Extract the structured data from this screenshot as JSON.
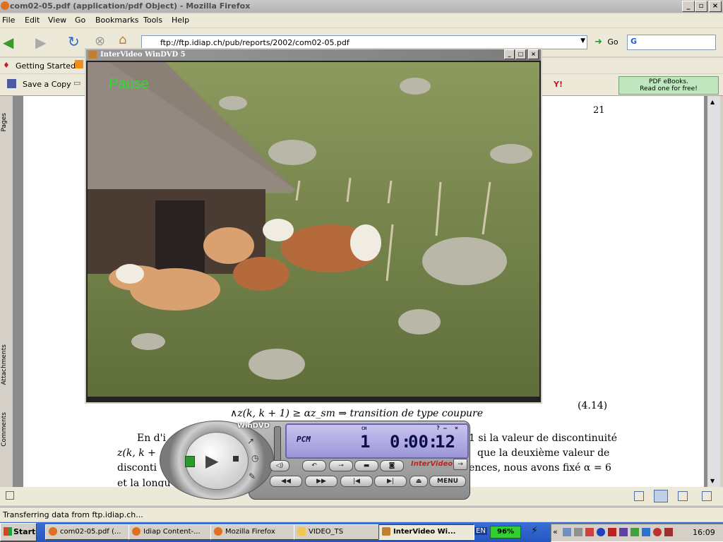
{
  "firefox": {
    "title": "com02-05.pdf (application/pdf Object) - Mozilla Firefox",
    "menu": [
      "File",
      "Edit",
      "View",
      "Go",
      "Bookmarks",
      "Tools",
      "Help"
    ],
    "url": "ftp://ftp.idiap.ch/pub/reports/2002/com02-05.pdf",
    "go_label": "Go",
    "bookmark": "Getting Started",
    "save_copy": "Save a Copy",
    "ebooks_line1": "PDF eBooks.",
    "ebooks_line2": "Read one for free!",
    "status": "Transferring data from ftp.idiap.ch..."
  },
  "pdf": {
    "page_number": "21",
    "side_tabs": [
      "Pages",
      "Attachments",
      "Comments"
    ],
    "equation": "∧z(k, k + 1) ≥ αz_sm ⇒ transition de type coupure",
    "equation_number": "(4.14)",
    "line1_left": "En d'i",
    "line1_right": "1 si la valeur de discontinuité",
    "line2_left": "z(k, k +",
    "line2_right": "que la deuxième valeur de",
    "line3_left": "disconti",
    "line3_right": "ences, nous avons fixé α = 6",
    "line4_left": "et la longu"
  },
  "windvd": {
    "title": "InterVideo WinDVD 5",
    "overlay": "Pause",
    "brand": "WinDVD",
    "audio_format": "PCM",
    "chapter_label": "CH",
    "chapter": "1",
    "time_h": "0",
    "time_m": "00",
    "time_s": "12",
    "vendor": "InterVideo",
    "menu_label": "MENU"
  },
  "taskbar": {
    "start": "Start",
    "tasks": [
      "com02-05.pdf (...",
      "Idiap Content-...",
      "Mozilla Firefox",
      "VIDEO_TS",
      "InterVideo Wi..."
    ],
    "lang": "EN",
    "battery": "96%",
    "clock": "16:09"
  }
}
